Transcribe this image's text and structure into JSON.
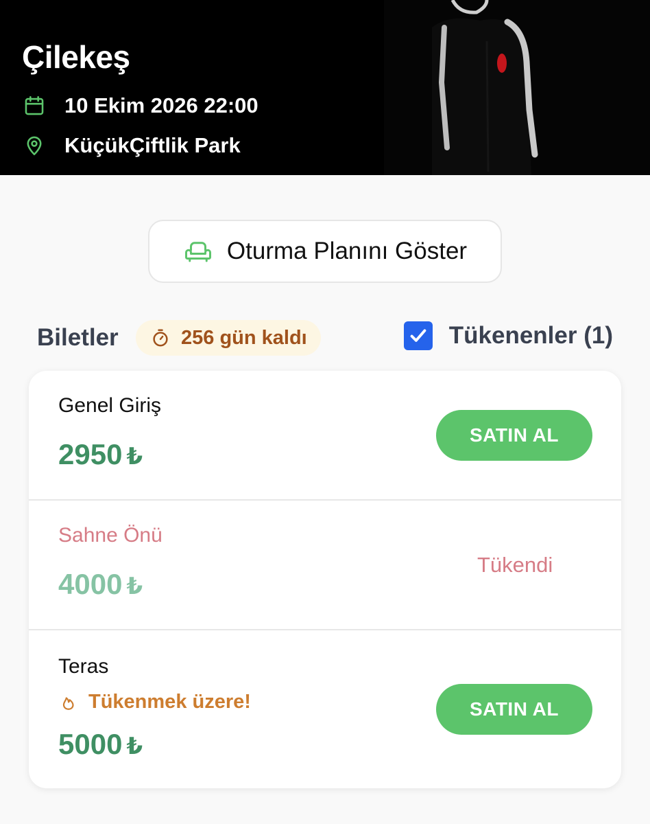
{
  "event": {
    "title": "Çilekeş",
    "datetime": "10 Ekim 2026 22:00",
    "venue": "KüçükÇiftlik Park"
  },
  "seating": {
    "button_label": "Oturma Planını Göster"
  },
  "tickets_header": {
    "title": "Biletler",
    "countdown": "256 gün kaldı",
    "soldout_filter_label": "Tükenenler (1)",
    "soldout_filter_checked": true
  },
  "tickets": [
    {
      "name": "Genel Giriş",
      "price": "2950",
      "currency": "₺",
      "status": "available",
      "action_label": "SATIN AL"
    },
    {
      "name": "Sahne Önü",
      "price": "4000",
      "currency": "₺",
      "status": "sold_out",
      "status_label": "Tükendi"
    },
    {
      "name": "Teras",
      "price": "5000",
      "currency": "₺",
      "status": "available",
      "badge": "Tükenmek üzere!",
      "action_label": "SATIN AL"
    }
  ],
  "colors": {
    "accent_green": "#5cc46b",
    "price_green": "#3f8f63",
    "sold_out_red": "#d67c86",
    "warning_orange": "#cd7d2f",
    "checkbox_blue": "#2563eb"
  },
  "icons": {
    "date": "calendar-icon",
    "venue": "map-pin-icon",
    "seating": "armchair-icon",
    "countdown": "stopwatch-icon",
    "filter": "checkmark-icon",
    "badge": "flame-icon"
  }
}
